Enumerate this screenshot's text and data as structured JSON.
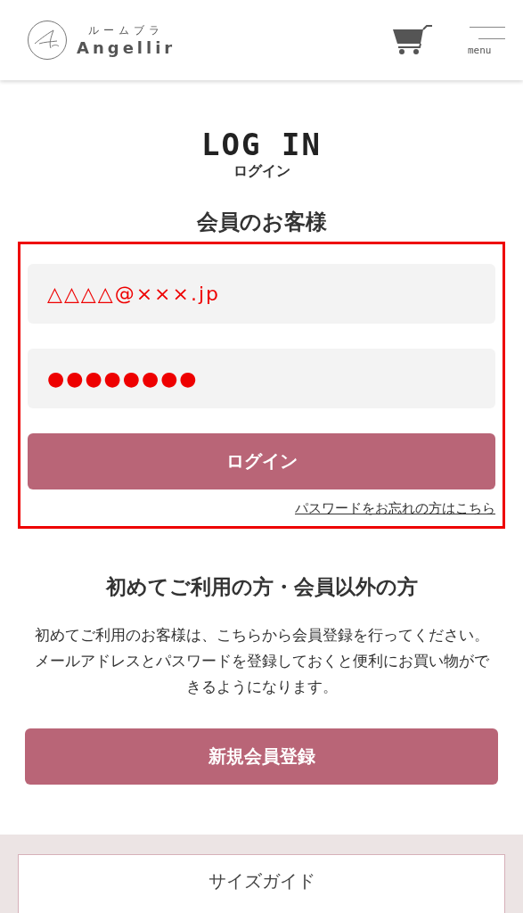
{
  "header": {
    "brand_kana": "ルームブラ",
    "brand": "Angellir",
    "menu_label": "menu"
  },
  "title": "LOG IN",
  "subtitle": "ログイン",
  "member": {
    "heading": "会員のお客様",
    "highlighted": true,
    "fields": [
      {
        "value": "△△△△@×××.jp"
      },
      {
        "value": "●●●●●●●●"
      }
    ],
    "button": "ログイン",
    "forgot_link": "パスワードをお忘れの方はこちら"
  },
  "guest": {
    "heading": "初めてご利用の方・会員以外の方",
    "paragraphs": [
      "初めてご利用のお客様は、こちらから会員登録を行ってください。",
      "メールアドレスとパスワードを登録しておくと便利にお買い物ができるようになります。"
    ],
    "button": "新規会員登録"
  },
  "footer": {
    "size_guide": "サイズガイド"
  }
}
